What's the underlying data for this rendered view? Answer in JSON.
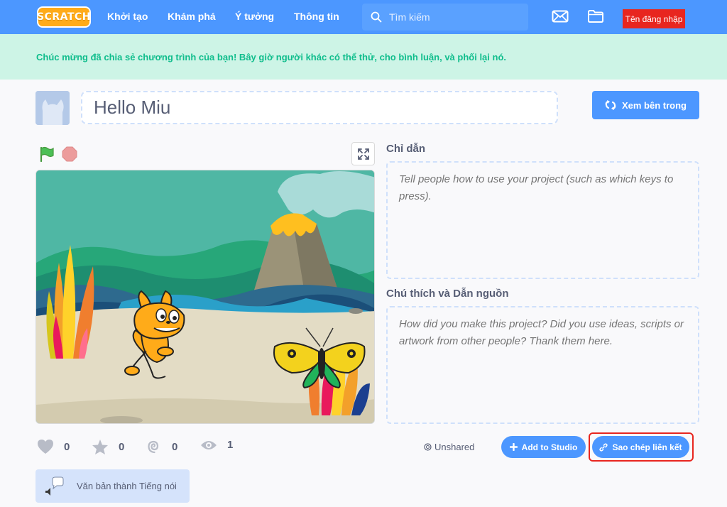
{
  "nav": {
    "logo_text": "SCRATCH",
    "links": [
      "Khởi tạo",
      "Khám phá",
      "Ý tưởng",
      "Thông tin"
    ],
    "search_placeholder": "Tìm kiếm",
    "login_label": "Tên đăng nhập",
    "color": "#4c97ff",
    "icons": [
      "message-icon",
      "folder-icon"
    ]
  },
  "banner": {
    "message": "Chúc mừng đã chia sẻ chương trình của bạn! Bây giờ người khác có thể thử, cho bình luận, và phối lại nó."
  },
  "project": {
    "title": "Hello Miu",
    "see_inside_label": "Xem bên trong"
  },
  "instructions": {
    "label": "Chỉ dẫn",
    "placeholder": "Tell people how to use your project (such as which keys to press)."
  },
  "notes": {
    "label": "Chú thích và Dẫn nguồn",
    "placeholder": "How did you make this project? Did you use ideas, scripts or artwork from other people? Thank them here."
  },
  "stats": {
    "loves": "0",
    "favorites": "0",
    "remixes": "0",
    "views": "1"
  },
  "sharing": {
    "status": "Unshared",
    "add_to_studio_label": "Add to Studio",
    "copy_link_label": "Sao chép liên kết"
  },
  "extension": {
    "label": "Văn bản thành Tiếng nói"
  }
}
